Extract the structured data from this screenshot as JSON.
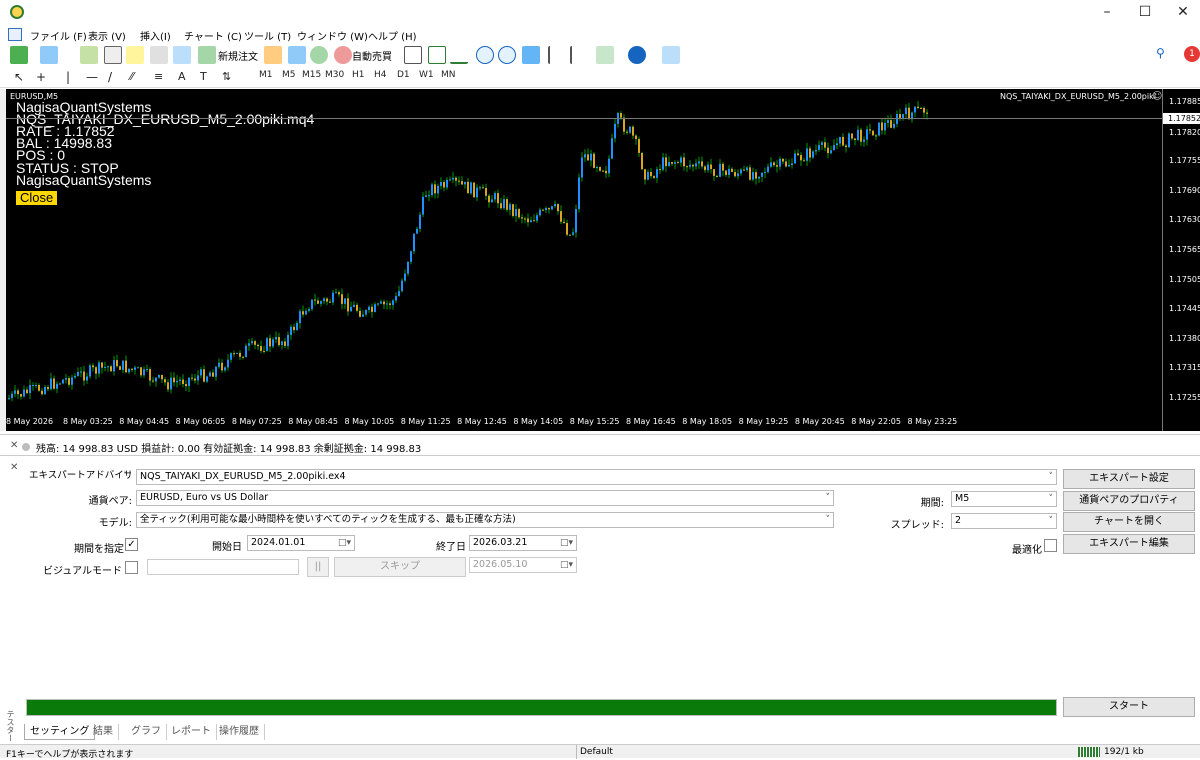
{
  "menu": [
    "ファイル (F)",
    "表示 (V)",
    "挿入(I)",
    "チャート (C)",
    "ツール (T)",
    "ウィンドウ (W)",
    "ヘルプ (H)"
  ],
  "toolbar": {
    "new_order": "新規注文",
    "auto_trading": "自動売買",
    "notif_count": "1"
  },
  "timeframes": [
    "M1",
    "M5",
    "M15",
    "M30",
    "H1",
    "H4",
    "D1",
    "W1",
    "MN"
  ],
  "chart": {
    "symbol_label": "EURUSD,M5",
    "ea_label": "NQS_TAIYAKI_DX_EURUSD_M5_2.00piki",
    "overlay": [
      "NagisaQuantSystems",
      "NQS_TAIYAKI_DX_EURUSD_M5_2.00piki.mq4",
      "RATE : 1.17852",
      "BAL : 14998.83",
      "POS : 0",
      "STATUS : STOP",
      "NagisaQuantSystems"
    ],
    "close_label": "Close",
    "current_price": "1.17852",
    "price_ticks": [
      "1.17885",
      "1.17820",
      "1.17755",
      "1.17690",
      "1.17630",
      "1.17565",
      "1.17505",
      "1.17445",
      "1.17380",
      "1.17315",
      "1.17255"
    ],
    "time_ticks": [
      "8 May 2026",
      "8 May 03:25",
      "8 May 04:45",
      "8 May 06:05",
      "8 May 07:25",
      "8 May 08:45",
      "8 May 10:05",
      "8 May 11:25",
      "8 May 12:45",
      "8 May 14:05",
      "8 May 15:25",
      "8 May 16:45",
      "8 May 18:05",
      "8 May 19:25",
      "8 May 20:45",
      "8 May 22:05",
      "8 May 23:25"
    ],
    "bull_color": "#1e90ff",
    "bear_color": "#daa520",
    "wick_color": "#00c000"
  },
  "account": "残高: 14 998.83 USD  損益計: 0.00  有効証拠金: 14 998.83  余剰証拠金: 14 998.83",
  "tester": {
    "ea_type": "エキスパートアドバイザ",
    "ea_file": "NQS_TAIYAKI_DX_EURUSD_M5_2.00piki.ex4",
    "pair_label": "通貨ペア:",
    "pair_value": "EURUSD, Euro vs US Dollar",
    "model_label": "モデル:",
    "model_value": "全ティック(利用可能な最小時間枠を使いすべてのティックを生成する、最も正確な方法)",
    "period_spec_label": "期間を指定",
    "start_label": "開始日",
    "start_value": "2024.01.01",
    "end_label": "終了日",
    "end_value": "2026.03.21",
    "visual_label": "ビジュアルモード",
    "skip_label": "スキップ",
    "skip_date": "2026.05.10",
    "pause_label": "||",
    "timeframe_label": "期間:",
    "timeframe_value": "M5",
    "spread_label": "スプレッド:",
    "spread_value": "2",
    "optimize_label": "最適化",
    "buttons": [
      "エキスパート設定",
      "通貨ペアのプロパティ",
      "チャートを開く",
      "エキスパート編集"
    ],
    "start_button": "スタート",
    "progress": 1.0,
    "tabs": [
      "セッティング",
      "結果",
      "グラフ",
      "レポート",
      "操作履歴"
    ],
    "side_label": "テスター"
  },
  "status": {
    "help": "F1キーでヘルプが表示されます",
    "profile": "Default",
    "traffic": "192/1 kb"
  }
}
